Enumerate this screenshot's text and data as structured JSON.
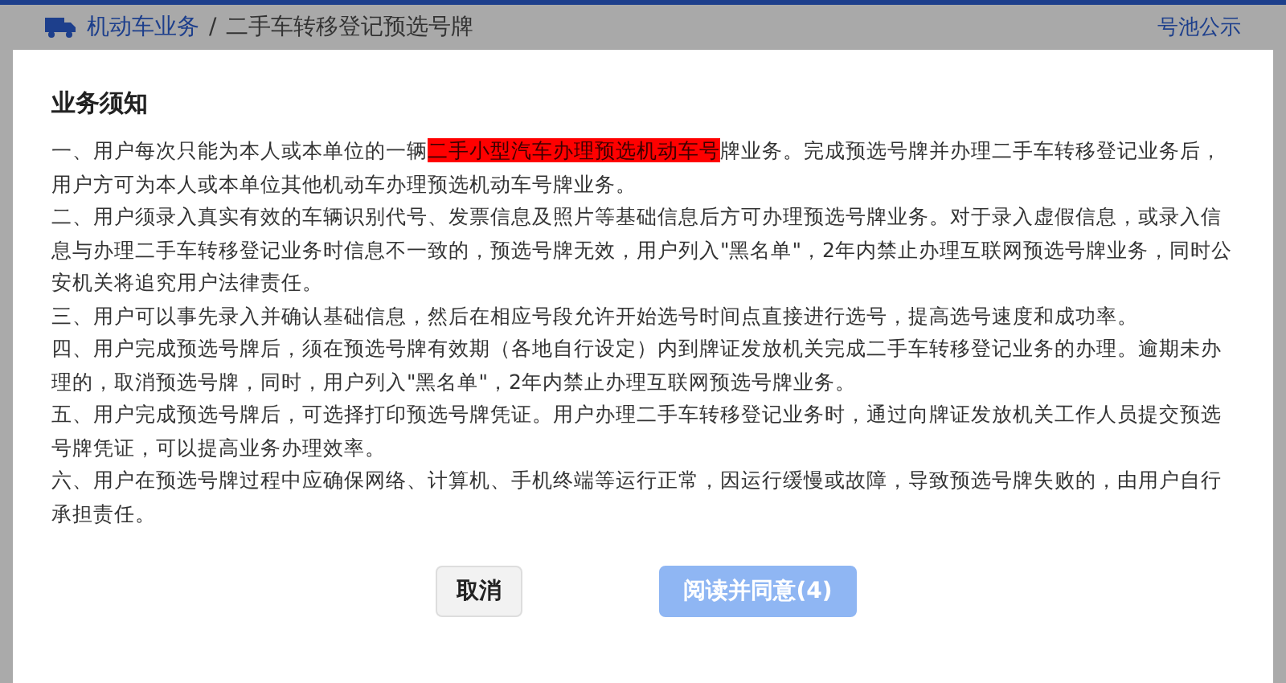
{
  "header": {
    "breadcrumb": [
      {
        "label": "机动车业务",
        "current": false
      },
      {
        "label": "二手车转移登记预选号牌",
        "current": true
      }
    ],
    "separator": "/",
    "right_link": "号池公示"
  },
  "dialog": {
    "title": "业务须知",
    "paragraphs": [
      [
        {
          "text": "一、用户每次只能为本人或本单位的一辆",
          "highlighted": false
        },
        {
          "text": "二手小型汽车办理预选机动车号",
          "highlighted": true
        },
        {
          "text": "牌业务。完成预选号牌并办理二手车转移登记业务后，用户方可为本人或本单位其他机动车办理预选机动车号牌业务。",
          "highlighted": false
        }
      ],
      [
        {
          "text": "二、用户须录入真实有效的车辆识别代号、发票信息及照片等基础信息后方可办理预选号牌业务。对于录入虚假信息，或录入信息与办理二手车转移登记业务时信息不一致的，预选号牌无效，用户列入\"黑名单\"，2年内禁止办理互联网预选号牌业务，同时公安机关将追究用户法律责任。",
          "highlighted": false
        }
      ],
      [
        {
          "text": "三、用户可以事先录入并确认基础信息，然后在相应号段允许开始选号时间点直接进行选号，提高选号速度和成功率。",
          "highlighted": false
        }
      ],
      [
        {
          "text": "四、用户完成预选号牌后，须在预选号牌有效期（各地自行设定）内到牌证发放机关完成二手车转移登记业务的办理。逾期未办理的，取消预选号牌，同时，用户列入\"黑名单\"，2年内禁止办理互联网预选号牌业务。",
          "highlighted": false
        }
      ],
      [
        {
          "text": "五、用户完成预选号牌后，可选择打印预选号牌凭证。用户办理二手车转移登记业务时，通过向牌证发放机关工作人员提交预选号牌凭证，可以提高业务办理效率。",
          "highlighted": false
        }
      ],
      [
        {
          "text": "六、用户在预选号牌过程中应确保网络、计算机、手机终端等运行正常，因运行缓慢或故障，导致预选号牌失败的，由用户自行承担责任。",
          "highlighted": false
        }
      ]
    ],
    "buttons": [
      {
        "label": "取消",
        "kind": "secondary",
        "disabled": false
      },
      {
        "label": "阅读并同意(4)",
        "kind": "primary",
        "disabled": true
      }
    ]
  }
}
